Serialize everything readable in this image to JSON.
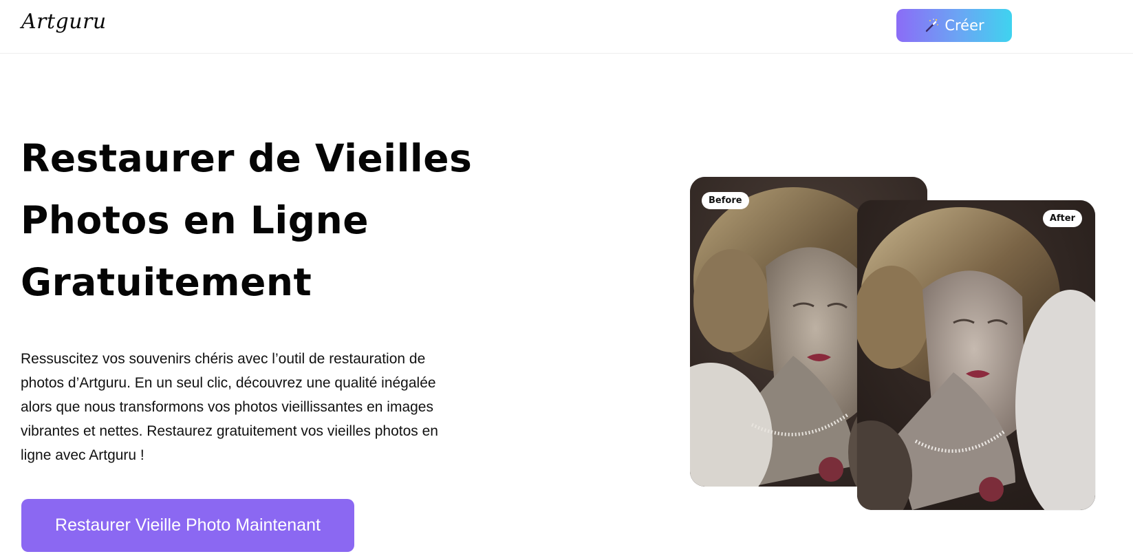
{
  "header": {
    "logo": "Artguru",
    "create_button": "Créer",
    "create_icon": "magic-wand-icon"
  },
  "hero": {
    "title_lines": [
      "Restaurer de Vieilles",
      "Photos en Ligne",
      "Gratuitement"
    ],
    "description_lines": [
      "Ressuscitez vos souvenirs chéris avec l’outil de restauration de",
      "photos d’Artguru. En un seul clic, découvrez une qualité inégalée",
      "alors que nous transformons vos photos vieillissantes en images",
      "vibrantes et nettes. Restaurez gratuitement vos vieilles photos en",
      "ligne avec Artguru !"
    ],
    "cta_button": "Restaurer Vieille Photo Maintenant"
  },
  "comparison": {
    "before_label": "Before",
    "after_label": "After"
  },
  "colors": {
    "accent": "#8b68f2",
    "gradient_start": "#8b6cf6",
    "gradient_end": "#3fd3ef"
  }
}
